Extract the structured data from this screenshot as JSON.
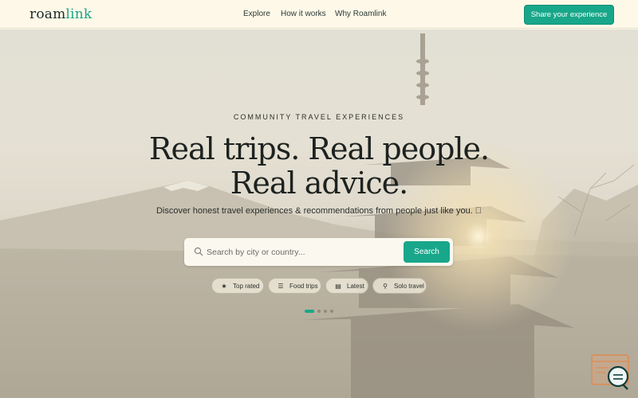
{
  "brand": {
    "logo_text_a": "roam",
    "logo_text_b": "link"
  },
  "nav": {
    "explore": "Explore",
    "how": "How it works",
    "why": "Why Roamlink"
  },
  "header": {
    "cta": "Share your experience"
  },
  "hero": {
    "eyebrow": "COMMUNITY TRAVEL EXPERIENCES",
    "headline_line1": "Real trips. Real people.",
    "headline_line2": "Real advice.",
    "subtitle": "Discover honest travel experiences & recommendations from people just like you. \u0000"
  },
  "search": {
    "placeholder": "Search by city or country...",
    "button": "Search"
  },
  "chips": [
    {
      "label": "Top rated",
      "icon": "star-icon"
    },
    {
      "label": "Food trips",
      "icon": "list-icon"
    },
    {
      "label": "Latest",
      "icon": "calendar-icon"
    },
    {
      "label": "Solo travel",
      "icon": "person-icon"
    }
  ],
  "carousel": {
    "slides": 4,
    "active": 1
  },
  "colors": {
    "accent": "#18a78a",
    "header_bg": "#fdf8e8",
    "text_dark": "#1d2220"
  }
}
